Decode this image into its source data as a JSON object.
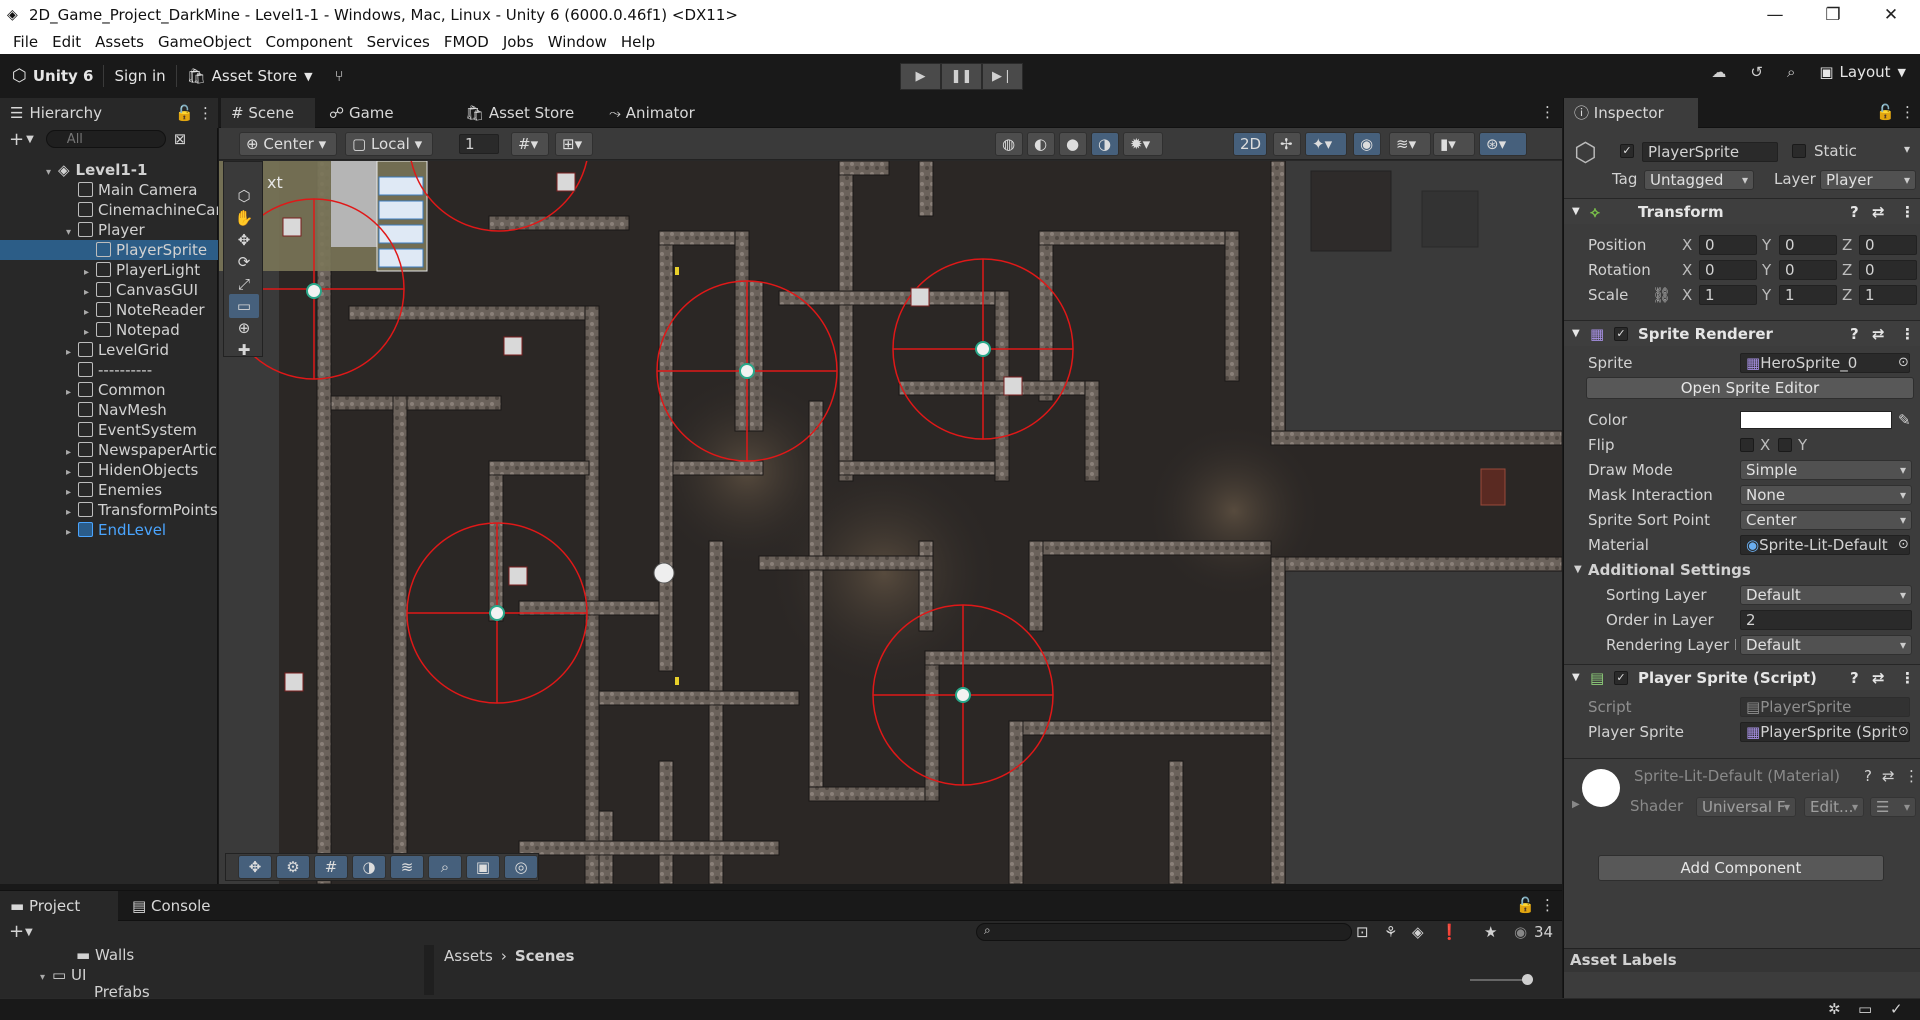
{
  "window": {
    "title": "2D_Game_Project_DarkMine - Level1-1 - Windows, Mac, Linux - Unity 6 (6000.0.46f1) <DX11>",
    "controls": [
      "—",
      "❐",
      "✕"
    ]
  },
  "menu": [
    "File",
    "Edit",
    "Assets",
    "GameObject",
    "Component",
    "Services",
    "FMOD",
    "Jobs",
    "Window",
    "Help"
  ],
  "toolbar": {
    "unity_label": "Unity 6",
    "sign_in": "Sign in",
    "asset_store": "Asset Store",
    "layout": "Layout"
  },
  "hierarchy": {
    "tab": "Hierarchy",
    "search_placeholder": "All",
    "items": [
      {
        "label": "Level1-1",
        "indent": 0,
        "arrow": "▾",
        "icon": "scene"
      },
      {
        "label": "Main Camera",
        "indent": 1,
        "arrow": "",
        "icon": "cube"
      },
      {
        "label": "CinemachineCan",
        "indent": 1,
        "arrow": "",
        "icon": "cube"
      },
      {
        "label": "Player",
        "indent": 1,
        "arrow": "▾",
        "icon": "cube"
      },
      {
        "label": "PlayerSprite",
        "indent": 2,
        "arrow": "",
        "icon": "cube",
        "selected": true
      },
      {
        "label": "PlayerLight",
        "indent": 2,
        "arrow": "▸",
        "icon": "cube"
      },
      {
        "label": "CanvasGUI",
        "indent": 2,
        "arrow": "▸",
        "icon": "cube"
      },
      {
        "label": "NoteReader",
        "indent": 2,
        "arrow": "▸",
        "icon": "cube"
      },
      {
        "label": "Notepad",
        "indent": 2,
        "arrow": "▸",
        "icon": "cube"
      },
      {
        "label": "LevelGrid",
        "indent": 1,
        "arrow": "▸",
        "icon": "cube"
      },
      {
        "label": "----------",
        "indent": 1,
        "arrow": "",
        "icon": "cube"
      },
      {
        "label": "Common",
        "indent": 1,
        "arrow": "▸",
        "icon": "cube"
      },
      {
        "label": "NavMesh",
        "indent": 1,
        "arrow": "",
        "icon": "cube"
      },
      {
        "label": "EventSystem",
        "indent": 1,
        "arrow": "",
        "icon": "cube"
      },
      {
        "label": "NewspaperArticl",
        "indent": 1,
        "arrow": "▸",
        "icon": "cube"
      },
      {
        "label": "HidenObjects",
        "indent": 1,
        "arrow": "▸",
        "icon": "cube"
      },
      {
        "label": "Enemies",
        "indent": 1,
        "arrow": "▸",
        "icon": "cube"
      },
      {
        "label": "TransformPoints",
        "indent": 1,
        "arrow": "▸",
        "icon": "cube"
      },
      {
        "label": "EndLevel",
        "indent": 1,
        "arrow": "▸",
        "icon": "prefab",
        "prefab": true
      }
    ]
  },
  "scene": {
    "tabs": [
      "Scene",
      "Game",
      "Asset Store",
      "Animator"
    ],
    "pivot": "Center",
    "space": "Local",
    "snap_value": "1",
    "mode_2d": "2D",
    "overlay_text": "xt"
  },
  "inspector": {
    "tab": "Inspector",
    "object_name": "PlayerSprite",
    "static_label": "Static",
    "tag_label": "Tag",
    "tag": "Untagged",
    "layer_label": "Layer",
    "layer": "Player",
    "transform": {
      "title": "Transform",
      "position_label": "Position",
      "rotation_label": "Rotation",
      "scale_label": "Scale",
      "position": [
        "0",
        "0",
        "0"
      ],
      "rotation": [
        "0",
        "0",
        "0"
      ],
      "scale": [
        "1",
        "1",
        "1"
      ]
    },
    "sprite_renderer": {
      "title": "Sprite Renderer",
      "sprite_label": "Sprite",
      "sprite": "HeroSprite_0",
      "open_editor": "Open Sprite Editor",
      "color_label": "Color",
      "flip_label": "Flip",
      "draw_mode_label": "Draw Mode",
      "draw_mode": "Simple",
      "mask_label": "Mask Interaction",
      "mask": "None",
      "sort_point_label": "Sprite Sort Point",
      "sort_point": "Center",
      "material_label": "Material",
      "material": "Sprite-Lit-Default",
      "additional": "Additional Settings",
      "sorting_layer_label": "Sorting Layer",
      "sorting_layer": "Default",
      "order_label": "Order in Layer",
      "order": "2",
      "rendering_layer_label": "Rendering Layer M",
      "rendering_layer": "Default"
    },
    "player_script": {
      "title": "Player Sprite (Script)",
      "script_label": "Script",
      "script": "PlayerSprite",
      "player_sprite_label": "Player Sprite",
      "player_sprite": "PlayerSprite (Sprit"
    },
    "material_block": {
      "title": "Sprite-Lit-Default (Material)",
      "shader_label": "Shader",
      "shader": "Universal F",
      "edit": "Edit..."
    },
    "add_component": "Add Component",
    "asset_labels": "Asset Labels"
  },
  "project": {
    "tabs": [
      "Project",
      "Console"
    ],
    "tree": [
      "Walls",
      "UI",
      "Prefabs"
    ],
    "breadcrumb": [
      "Assets",
      "Scenes"
    ],
    "count": "34"
  },
  "colors": {
    "accent": "#2c5d87",
    "prefab": "#4aa5ff",
    "gizmo": "#e01818"
  }
}
